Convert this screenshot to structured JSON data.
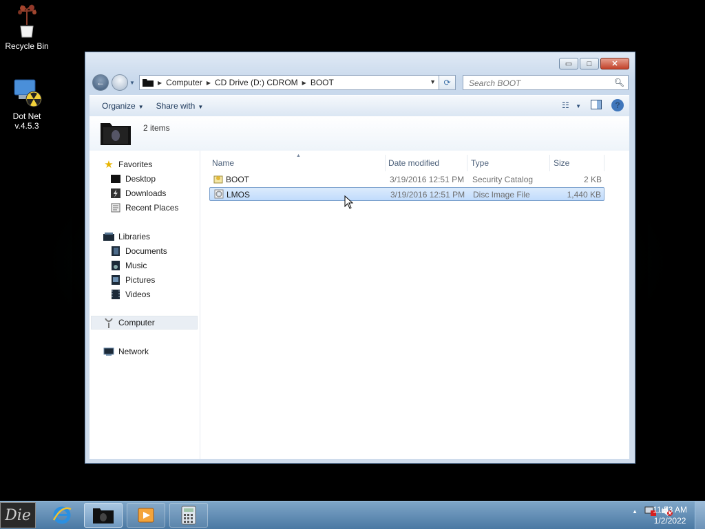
{
  "desktop": {
    "icons": [
      {
        "label": "Recycle Bin"
      },
      {
        "label_line1": "Dot Net",
        "label_line2": "v.4.5.3"
      }
    ]
  },
  "window": {
    "caption_buttons": {
      "minimize": "▭",
      "maximize": "□",
      "close": "✕"
    },
    "address": {
      "segments": [
        "Computer",
        "CD Drive (D:) CDROM",
        "BOOT"
      ]
    },
    "search": {
      "placeholder": "Search BOOT"
    },
    "toolbar": {
      "organize_label": "Organize",
      "share_label": "Share with"
    },
    "info": {
      "item_count": "2 items"
    },
    "nav_pane": {
      "favorites": {
        "label": "Favorites",
        "items": [
          "Desktop",
          "Downloads",
          "Recent Places"
        ]
      },
      "libraries": {
        "label": "Libraries",
        "items": [
          "Documents",
          "Music",
          "Pictures",
          "Videos"
        ]
      },
      "computer": {
        "label": "Computer"
      },
      "network": {
        "label": "Network"
      }
    },
    "columns": {
      "name": "Name",
      "date_modified": "Date modified",
      "type": "Type",
      "size": "Size"
    },
    "files": [
      {
        "name": "BOOT",
        "date_modified": "3/19/2016 12:51 PM",
        "type": "Security Catalog",
        "size": "2 KB",
        "selected": false
      },
      {
        "name": "LMOS",
        "date_modified": "3/19/2016 12:51 PM",
        "type": "Disc Image File",
        "size": "1,440 KB",
        "selected": true
      }
    ]
  },
  "taskbar": {
    "start_label": "Die",
    "clock": {
      "time": "11:53 AM",
      "date": "1/2/2022"
    },
    "tray_expand": "▲"
  },
  "colors": {
    "selection": "#c1dcfc",
    "taskbar": "#4a78a3",
    "window_frame": "#c9d9ec"
  }
}
